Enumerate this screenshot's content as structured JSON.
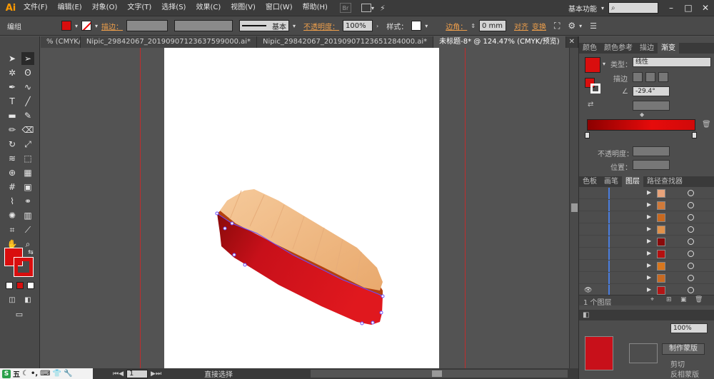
{
  "menubar": {
    "logo": "Ai",
    "items": [
      "文件(F)",
      "编辑(E)",
      "对象(O)",
      "文字(T)",
      "选择(S)",
      "效果(C)",
      "视图(V)",
      "窗口(W)",
      "帮助(H)"
    ],
    "br_label": "Br",
    "workspace": "基本功能",
    "search_placeholder": ""
  },
  "controlbar": {
    "selection": "编组",
    "stroke_label": "描边：",
    "stroke_style": "基本",
    "opacity_label": "不透明度：",
    "opacity_value": "100%",
    "style_label": "样式：",
    "corner_label": "边角：",
    "corner_value": "0 mm",
    "align_label": "对齐",
    "transform_label": "变换"
  },
  "tabs": [
    {
      "label": "% (CMYK/...",
      "active": false
    },
    {
      "label": "Nipic_29842067_20190907123637599000.ai*",
      "active": false
    },
    {
      "label": "Nipic_29842067_20190907123651284000.ai*",
      "active": false
    },
    {
      "label": "未标题-8* @ 124.47% (CMYK/预览)",
      "active": true
    }
  ],
  "status": {
    "zoom": "124.47%",
    "page": "1",
    "tool_name": "直接选择"
  },
  "ime": {
    "items": [
      "五",
      "☾",
      "•,",
      "⌨",
      "👕",
      "🔧"
    ]
  },
  "gradient_panel": {
    "tabs": [
      "颜色",
      "颜色参考",
      "描边",
      "渐变"
    ],
    "active_tab": "渐变",
    "type_label": "类型：",
    "type_value": "线性",
    "stroke_label": "描边",
    "angle_value": "-29.4°",
    "opacity_label": "不透明度：",
    "location_label": "位置："
  },
  "layers_panel": {
    "tabs": [
      "色板",
      "画笔",
      "图层",
      "路径查找器"
    ],
    "active_tab": "图层",
    "count_label": "1 个图层",
    "rows": [
      {
        "visible": false,
        "thumb": "#e8a37a"
      },
      {
        "visible": false,
        "thumb": "#d07a3a"
      },
      {
        "visible": false,
        "thumb": "#c9691f"
      },
      {
        "visible": false,
        "thumb": "#e0914a"
      },
      {
        "visible": false,
        "thumb": "#8a0a0a"
      },
      {
        "visible": false,
        "thumb": "#b51010"
      },
      {
        "visible": false,
        "thumb": "#d8771e"
      },
      {
        "visible": false,
        "thumb": "#c86a22"
      },
      {
        "visible": true,
        "thumb": "#b31515"
      }
    ]
  },
  "transparency_panel": {
    "opacity_value": "100%",
    "mask_button": "制作蒙版",
    "clip_label": "剪切",
    "invert_label": "反相蒙版"
  },
  "colors": {
    "fill": "#d90e0e",
    "boat_red": "#c8101a",
    "deck": "#f0c090",
    "accent": "#ff9a00"
  }
}
